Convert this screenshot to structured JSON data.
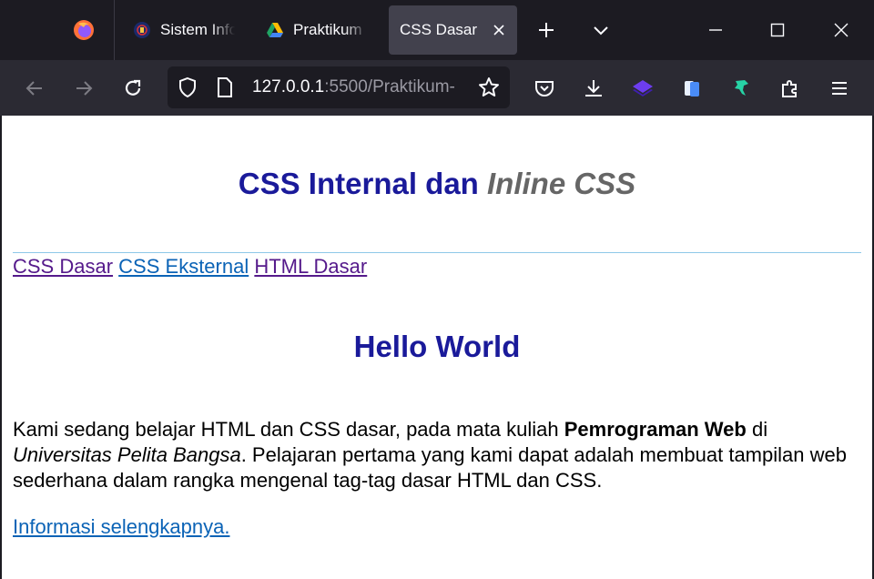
{
  "browser": {
    "tabs": [
      {
        "title": "Sistem Informasi",
        "icon": "university-logo-icon"
      },
      {
        "title": "Praktikum",
        "icon": "google-drive-icon"
      },
      {
        "title": "CSS Dasar",
        "icon": "",
        "active": true
      }
    ],
    "url": {
      "host": "127.0.0.1",
      "rest": ":5500/Praktikum-"
    },
    "colors": {
      "chrome_dark": "#1c1b22",
      "toolbar": "#2b2a33",
      "active_tab": "#42414d"
    }
  },
  "page": {
    "heading": {
      "part1": "CSS Internal dan ",
      "part2": "Inline CSS"
    },
    "nav_links": [
      "CSS Dasar",
      "CSS Eksternal",
      "HTML Dasar"
    ],
    "title": "Hello World",
    "paragraph": {
      "t1": "Kami sedang belajar HTML dan CSS dasar, pada mata kuliah ",
      "bold": "Pemrograman Web",
      "t2": " di ",
      "italic": "Universitas Pelita Bangsa",
      "t3": ". Pelajaran pertama yang kami dapat adalah membuat tampilan web sederhana dalam rangka mengenal tag-tag dasar HTML dan CSS."
    },
    "more_link": "Informasi selengkapnya.",
    "colors": {
      "heading": "#1a1a9a",
      "heading_italic": "#666666",
      "link": "#0b63b6",
      "visited": "#551a8b",
      "rule": "#8ec8e8"
    }
  }
}
